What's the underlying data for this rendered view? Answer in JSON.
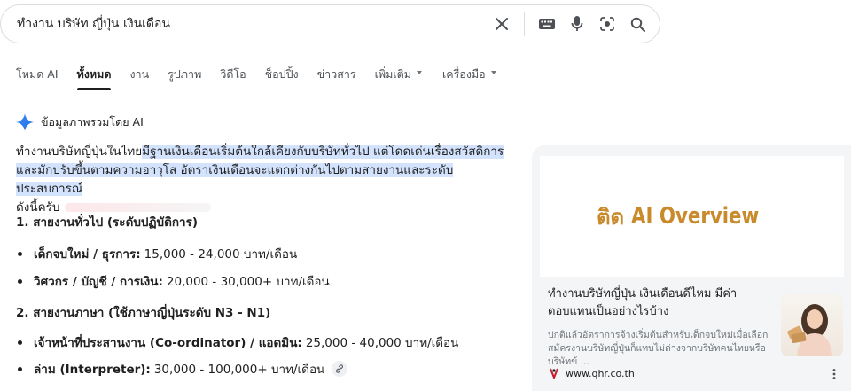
{
  "search": {
    "query": "ทำงาน บริษัท ญี่ปุ่น เงินเดือน"
  },
  "tabs": [
    {
      "label": "โหมด AI"
    },
    {
      "label": "ทั้งหมด"
    },
    {
      "label": "งาน"
    },
    {
      "label": "รูปภาพ"
    },
    {
      "label": "วิดีโอ"
    },
    {
      "label": "ช็อปปิ้ง"
    },
    {
      "label": "ข่าวสาร"
    },
    {
      "label": "เพิ่มเติม"
    },
    {
      "label": "เครื่องมือ"
    }
  ],
  "ai_overview": {
    "header": "ข้อมูลภาพรวมโดย AI",
    "intro_plain": "ทำงานบริษัทญี่ปุ่นในไทย",
    "intro_hl_1": "มีฐานเงินเดือนเริ่มต้นใกล้เคียงกับบริษัททั่วไป แต่โดดเด่นเรื่องสวัสดิการ",
    "intro_hl_2": "และมักปรับขึ้นตามความอาวุโส อัตราเงินเดือนจะแตกต่างกันไปตามสายงานและระดับประสบการณ์",
    "intro_tail": "ดังนี้ครับ",
    "section1_title": "1. สายงานทั่วไป (ระดับปฏิบัติการ)",
    "section1_items": [
      {
        "label": "เด็กจบใหม่ / ธุรการ:",
        "value": "15,000 - 24,000 บาท/เดือน"
      },
      {
        "label": "วิศวกร / บัญชี / การเงิน:",
        "value": "20,000 - 30,000+ บาท/เดือน"
      }
    ],
    "section2_title": "2. สายงานภาษา (ใช้ภาษาญี่ปุ่นระดับ N3 - N1)",
    "section2_items": [
      {
        "label": "เจ้าหน้าที่ประสานงาน (Co-ordinator) / แอดมิน:",
        "value": "25,000 - 40,000 บาท/เดือน"
      },
      {
        "label": "ล่าม (Interpreter):",
        "value": "30,000 - 100,000+ บาท/เดือน"
      }
    ]
  },
  "side_card": {
    "banner_prefix": "ติด",
    "banner_main": "AI Overview",
    "title": "ทำงานบริษัทญี่ปุ่น เงินเดือนดีไหม มีค่าตอบแทนเป็นอย่างไรบ้าง",
    "snippet": "ปกติแล้วอัตราการจ้างเริ่มต้นสำหรับเด็กจบใหม่เมื่อเลือกสมัครงานบริษัทญี่ปุ่นก็แทบไม่ต่างจากบริษัทคนไทยหรือบริษัทข้ ...",
    "site": "www.qhr.co.th",
    "accent": "#c98a2c"
  }
}
